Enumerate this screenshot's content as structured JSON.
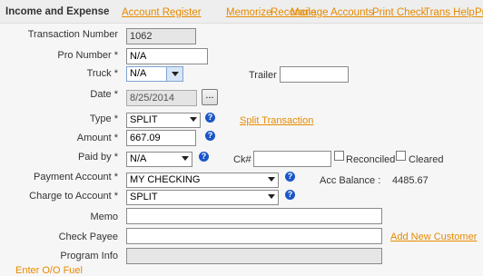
{
  "header": {
    "title": "Income and Expense",
    "nav": [
      "Account Register",
      "Memorize",
      "Reconcile",
      "Manage Accounts",
      "Print Check",
      "Trans Help",
      "Pr"
    ]
  },
  "labels": {
    "transaction_number": "Transaction Number",
    "pro_number": "Pro Number *",
    "truck": "Truck *",
    "trailer": "Trailer",
    "date": "Date *",
    "type": "Type *",
    "amount": "Amount *",
    "paid_by": "Paid by *",
    "check_num": "Ck#",
    "reconciled": "Reconciled",
    "cleared": "Cleared",
    "payment_account": "Payment Account *",
    "acc_balance": "Acc Balance :",
    "charge_to_account": "Charge to Account *",
    "memo": "Memo",
    "check_payee": "Check Payee",
    "program_info": "Program Info"
  },
  "values": {
    "transaction_number": "1062",
    "pro_number": "N/A",
    "truck": "N/A",
    "trailer": "",
    "date": "8/25/2014",
    "type": "SPLIT",
    "amount": "667.09",
    "paid_by": "N/A",
    "check_num": "",
    "payment_account": "MY CHECKING",
    "acc_balance": "4485.67",
    "charge_to_account": "SPLIT",
    "memo": "",
    "check_payee": "",
    "program_info": ""
  },
  "links": {
    "split_transaction": "Split Transaction",
    "add_new_customer": "Add New Customer",
    "enter_oo_fuel": "Enter O/O Fuel"
  },
  "buttons": {
    "date_picker": "..."
  },
  "icons": {
    "help": "?",
    "help_icon_name": "help-icon",
    "dropdown_icon_name": "chevron-down-icon"
  },
  "colors": {
    "link": "#e68a00",
    "help": "#1a56c8",
    "header_bg": "#eeeeee",
    "form_bg": "#f6f6f6"
  }
}
